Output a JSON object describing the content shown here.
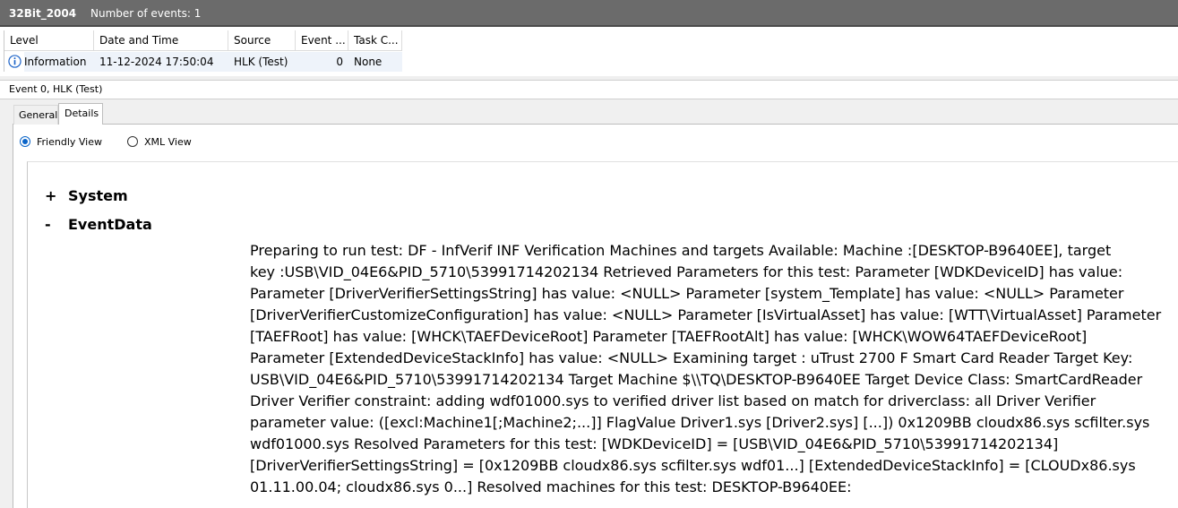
{
  "titlebar": {
    "log_name": "32Bit_2004",
    "event_count": "Number of events: 1"
  },
  "grid": {
    "columns": [
      "Level",
      "Date and Time",
      "Source",
      "Event ...",
      "Task C..."
    ],
    "row": {
      "level": "Information",
      "date_time": "11-12-2024 17:50:04",
      "source": "HLK (Test)",
      "event_id": "0",
      "task_category": "None"
    }
  },
  "detail_pane": {
    "title": "Event 0, HLK (Test)"
  },
  "tabs": {
    "general": "General",
    "details": "Details"
  },
  "view_options": {
    "friendly": "Friendly View",
    "xml": "XML View"
  },
  "sections": {
    "system": {
      "toggle": "+",
      "label": "System"
    },
    "eventdata": {
      "toggle": "-",
      "label": "EventData"
    }
  },
  "event_data_lines": [
    "Preparing to run test: DF - InfVerif INF Verification Machines and targets Available: Machine :[DESKTOP-B9640EE], target",
    "key :USB\\VID_04E6&PID_5710\\53991714202134 Retrieved Parameters for this test: Parameter [WDKDeviceID] has value:",
    "Parameter [DriverVerifierSettingsString] has value: <NULL> Parameter [system_Template] has value: <NULL> Parameter",
    "[DriverVerifierCustomizeConfiguration] has value: <NULL> Parameter [IsVirtualAsset] has value: [WTT\\VirtualAsset] Parameter",
    "[TAEFRoot] has value: [WHCK\\TAEFDeviceRoot] Parameter [TAEFRootAlt] has value: [WHCK\\WOW64TAEFDeviceRoot]",
    "Parameter [ExtendedDeviceStackInfo] has value: <NULL> Examining target : uTrust 2700 F Smart Card Reader Target Key:",
    "USB\\VID_04E6&PID_5710\\53991714202134 Target Machine $\\\\TQ\\DESKTOP-B9640EE Target Device Class: SmartCardReader",
    "Driver Verifier constraint: adding wdf01000.sys to verified driver list based on match for driverclass: all Driver Verifier",
    "parameter value: ([excl:Machine1[;Machine2;...]] FlagValue Driver1.sys [Driver2.sys] [...]) 0x1209BB cloudx86.sys scfilter.sys",
    "wdf01000.sys Resolved Parameters for this test: [WDKDeviceID] = [USB\\VID_04E6&PID_5710\\53991714202134]",
    "[DriverVerifierSettingsString] = [0x1209BB cloudx86.sys scfilter.sys wdf01...] [ExtendedDeviceStackInfo] = [CLOUDx86.sys",
    "01.11.00.04; cloudx86.sys 0...] Resolved machines for this test: DESKTOP-B9640EE:"
  ],
  "colors": {
    "titlebar": "#6b6b6b",
    "selection": "#eef3fa",
    "radio_accent": "#0a64c8",
    "info_icon": "#1e64c8"
  },
  "icons": {
    "level_icon": "information-icon"
  }
}
